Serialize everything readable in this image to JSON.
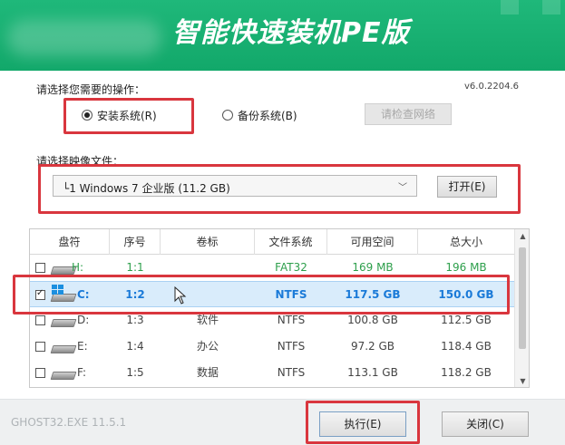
{
  "header": {
    "title": "智能快速装机PE版"
  },
  "version": "v6.0.2204.6",
  "operation": {
    "label": "请选择您需要的操作：",
    "install_label": "安装系统(R)",
    "backup_label": "备份系统(B)",
    "network_label": "请检查网络"
  },
  "image": {
    "label": "请选择映像文件：",
    "selected": "└1 Windows 7 企业版 (11.2 GB)",
    "open_label": "打开(E)"
  },
  "table": {
    "headers": [
      "盘符",
      "序号",
      "卷标",
      "文件系统",
      "可用空间",
      "总大小"
    ],
    "rows": [
      {
        "drive": "H:",
        "index": "1:1",
        "label": "",
        "fs": "FAT32",
        "free": "169 MB",
        "total": "196 MB",
        "checked": false,
        "selected": false,
        "style": "green"
      },
      {
        "drive": "C:",
        "index": "1:2",
        "label": "",
        "fs": "NTFS",
        "free": "117.5 GB",
        "total": "150.0 GB",
        "checked": true,
        "selected": true,
        "style": "blue"
      },
      {
        "drive": "D:",
        "index": "1:3",
        "label": "软件",
        "fs": "NTFS",
        "free": "100.8 GB",
        "total": "112.5 GB",
        "checked": false,
        "selected": false,
        "style": "gray"
      },
      {
        "drive": "E:",
        "index": "1:4",
        "label": "办公",
        "fs": "NTFS",
        "free": "97.2 GB",
        "total": "118.4 GB",
        "checked": false,
        "selected": false,
        "style": "gray"
      },
      {
        "drive": "F:",
        "index": "1:5",
        "label": "数据",
        "fs": "NTFS",
        "free": "113.1 GB",
        "total": "118.2 GB",
        "checked": false,
        "selected": false,
        "style": "gray"
      }
    ]
  },
  "footer": {
    "ghost": "GHOST32.EXE 11.5.1",
    "execute_label": "执行(E)",
    "close_label": "关闭(C)"
  },
  "colors": {
    "header": "#12a86a",
    "highlight": "#d9363e",
    "selected_row": "#d9ecfb"
  }
}
